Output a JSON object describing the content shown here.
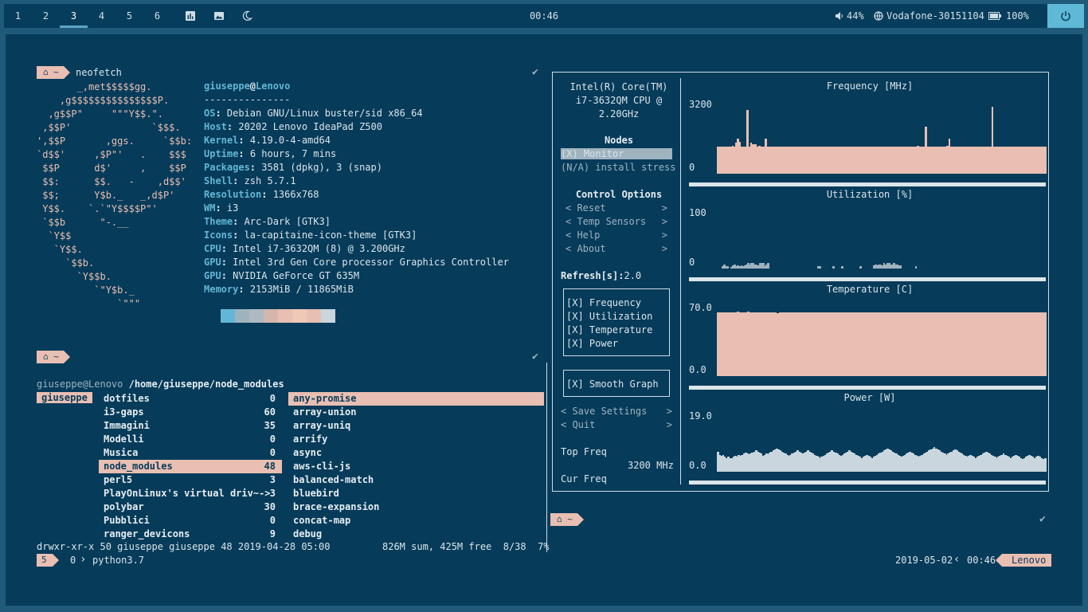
{
  "topbar": {
    "workspaces": [
      "1",
      "2",
      "3",
      "4",
      "5",
      "6"
    ],
    "active_workspace": "3",
    "clock": "00:46",
    "volume": "44%",
    "network": "Vodafone-30151104",
    "battery": "100%"
  },
  "term1": {
    "prompt_dir": "~",
    "command": "neofetch",
    "logo_lines": [
      "       _,met$$$$$gg.",
      "    ,g$$$$$$$$$$$$$$$P.",
      "  ,g$$P\"     \"\"\"Y$$.\".",
      " ,$$P'              `$$$.",
      "',$$P       ,ggs.     `$$b:",
      "`d$$'     ,$P\"'   .    $$$",
      " $$P      d$'     ,    $$P",
      " $$:      $$.   -    ,d$$'",
      " $$;      Y$b._   _,d$P'",
      " Y$$.    `.`\"Y$$$$P\"'",
      " `$$b      \"-.__",
      "  `Y$$",
      "   `Y$$.",
      "     `$$b.",
      "       `Y$$b.",
      "          `\"Y$b._",
      "              `\"\"\""
    ],
    "user": "giuseppe",
    "host": "Lenovo",
    "divider": "---------------",
    "info": [
      {
        "k": "OS",
        "v": "Debian GNU/Linux buster/sid x86_64"
      },
      {
        "k": "Host",
        "v": "20202 Lenovo IdeaPad Z500"
      },
      {
        "k": "Kernel",
        "v": "4.19.0-4-amd64"
      },
      {
        "k": "Uptime",
        "v": "6 hours, 7 mins"
      },
      {
        "k": "Packages",
        "v": "3581 (dpkg), 3 (snap)"
      },
      {
        "k": "Shell",
        "v": "zsh 5.7.1"
      },
      {
        "k": "Resolution",
        "v": "1366x768"
      },
      {
        "k": "WM",
        "v": "i3"
      },
      {
        "k": "Theme",
        "v": "Arc-Dark [GTK3]"
      },
      {
        "k": "Icons",
        "v": "la-capitaine-icon-theme [GTK3]"
      },
      {
        "k": "CPU",
        "v": "Intel i7-3632QM (8) @ 3.200GHz"
      },
      {
        "k": "GPU",
        "v": "Intel 3rd Gen Core processor Graphics Controller"
      },
      {
        "k": "GPU",
        "v": "NVIDIA GeForce GT 635M"
      },
      {
        "k": "Memory",
        "v": "2153MiB / 11865MiB"
      }
    ],
    "palette": [
      "#63b7d6",
      "#9fb3bf",
      "#aebac2",
      "#d4b6ad",
      "#e8bfb2",
      "#f0c8b8",
      "#e8bfb2",
      "#c9d6dd"
    ]
  },
  "ranger": {
    "prompt_dir": "~",
    "path_user": "giuseppe@Lenovo",
    "path": "/home/giuseppe/node_modules",
    "parent_dir": "giuseppe",
    "dirs": [
      {
        "name": "dotfiles",
        "count": "0"
      },
      {
        "name": "i3-gaps",
        "count": "60"
      },
      {
        "name": "Immagini",
        "count": "35"
      },
      {
        "name": "Modelli",
        "count": "0"
      },
      {
        "name": "Musica",
        "count": "0"
      },
      {
        "name": "node_modules",
        "count": "48"
      },
      {
        "name": "perl5",
        "count": "3"
      },
      {
        "name": "PlayOnLinux's virtual driv~-> ",
        "count": "3"
      },
      {
        "name": "polybar",
        "count": "30"
      },
      {
        "name": "Pubblici",
        "count": "0"
      },
      {
        "name": "ranger_devicons",
        "count": "9"
      }
    ],
    "selected_dir": "node_modules",
    "preview": [
      "any-promise",
      "array-union",
      "array-uniq",
      "arrify",
      "async",
      "aws-cli-js",
      "balanced-match",
      "bluebird",
      "brace-expansion",
      "concat-map",
      "debug"
    ],
    "status_left": "drwxr-xr-x 50 giuseppe giuseppe 48 2019-04-28 05:00",
    "status_right": "826M sum, 425M free  8/38  7%",
    "tmux_window": "5",
    "tmux_pane": "0",
    "tmux_proc": "python3.7"
  },
  "monitor": {
    "cpu_name": [
      "Intel(R) Core(TM)",
      "i7-3632QM CPU @",
      "2.20GHz"
    ],
    "nodes_title": "Nodes",
    "nodes": [
      "(X) Monitor",
      "(N/A) install stress"
    ],
    "control_title": "Control Options",
    "controls": [
      "Reset",
      "Temp Sensors",
      "Help",
      "About"
    ],
    "refresh_label": "Refresh[s]:",
    "refresh_value": "2.0",
    "checks": [
      "[X] Frequency",
      "[X] Utilization",
      "[X] Temperature",
      "[X] Power"
    ],
    "smooth": "[X] Smooth Graph",
    "save": "Save Settings",
    "quit": "Quit",
    "top_freq_label": "Top Freq",
    "top_freq_value": "3200 MHz",
    "cur_freq_label": "Cur Freq",
    "graphs": [
      {
        "title": "Frequency [MHz]",
        "ymax": "3200",
        "ymin": "0",
        "color": "#e8bfb2",
        "values": [
          40,
          40,
          40,
          40,
          40,
          40,
          40,
          40,
          40,
          42,
          40,
          46,
          52,
          48,
          40,
          40,
          40,
          40,
          95,
          40,
          46,
          44,
          44,
          44,
          40,
          42,
          40,
          40,
          40,
          52,
          40,
          40,
          40,
          40,
          40,
          40,
          40,
          40,
          40,
          40,
          40,
          40,
          40,
          40,
          40,
          40,
          40,
          40,
          40,
          40,
          40,
          40,
          40,
          40,
          40,
          40,
          40,
          40,
          40,
          40,
          40,
          40,
          40,
          40,
          40,
          40,
          40,
          40,
          40,
          40,
          40,
          40,
          40,
          40,
          40,
          40,
          40,
          40,
          40,
          40,
          40,
          40,
          40,
          40,
          40,
          40,
          40,
          40,
          40,
          40,
          40,
          40,
          40,
          40,
          40,
          40,
          40,
          40,
          40,
          40,
          40,
          40,
          40,
          40,
          40,
          40,
          40,
          40,
          40,
          40,
          40,
          40,
          40,
          40,
          40,
          40,
          40,
          40,
          40,
          40,
          40,
          42,
          40,
          40,
          40,
          40,
          70,
          40,
          40,
          40,
          40,
          40,
          40,
          40,
          40,
          40,
          40,
          40,
          40,
          42,
          52,
          40,
          40,
          40,
          40,
          40,
          40,
          40,
          40,
          40,
          40,
          40,
          40,
          40,
          40,
          40,
          40,
          40,
          40,
          40,
          40,
          40,
          40,
          40,
          40,
          40,
          100,
          40,
          40,
          40,
          40,
          40,
          40,
          40,
          40,
          40,
          40,
          40,
          40,
          40,
          40,
          40,
          40,
          40,
          40,
          40,
          40,
          40,
          40,
          40,
          40,
          40,
          40,
          40,
          40,
          40,
          40,
          40,
          40
        ]
      },
      {
        "title": "Utilization [%]",
        "ymax": "100",
        "ymin": "0",
        "color": "#9fb3bf",
        "values": [
          0,
          0,
          0,
          5,
          8,
          4,
          4,
          0,
          3,
          6,
          8,
          4,
          6,
          4,
          6,
          5,
          6,
          8,
          10,
          8,
          10,
          10,
          8,
          8,
          6,
          10,
          10,
          10,
          5,
          8,
          10,
          0,
          0,
          0,
          0,
          0,
          0,
          0,
          0,
          0,
          0,
          0,
          0,
          0,
          0,
          0,
          0,
          0,
          0,
          0,
          0,
          0,
          0,
          0,
          0,
          0,
          0,
          0,
          0,
          0,
          5,
          5,
          0,
          0,
          0,
          0,
          0,
          0,
          0,
          5,
          0,
          0,
          0,
          0,
          5,
          0,
          0,
          0,
          0,
          0,
          0,
          0,
          0,
          0,
          0,
          4,
          0,
          0,
          0,
          0,
          0,
          0,
          0,
          6,
          8,
          6,
          8,
          8,
          6,
          10,
          8,
          10,
          10,
          8,
          8,
          10,
          8,
          8,
          6,
          6,
          0,
          0,
          0,
          0,
          0,
          0,
          0,
          0,
          5,
          0,
          0,
          0,
          0,
          0,
          0,
          0,
          0,
          0,
          0,
          0,
          0,
          0,
          0,
          0,
          0,
          0,
          0,
          0,
          0,
          0,
          0,
          0,
          0,
          0,
          0,
          0,
          0,
          0,
          0,
          0,
          0,
          0,
          0,
          0,
          0,
          0,
          0,
          0,
          0,
          0,
          0,
          0,
          0,
          0,
          0,
          0,
          0,
          0,
          0,
          0,
          0,
          0,
          0,
          0,
          0,
          0,
          0,
          0,
          0,
          0,
          0,
          0,
          0,
          0,
          0,
          0,
          0,
          0,
          0,
          0,
          0,
          0,
          0,
          0,
          0,
          0
        ]
      },
      {
        "title": "Temperature [C]",
        "ymax": "70.0",
        "ymin": "0.0",
        "color": "#e8bfb2",
        "values": [
          96,
          97,
          96,
          96,
          97,
          96,
          96,
          96,
          97,
          96,
          97,
          97,
          98,
          96,
          96,
          97,
          96,
          97,
          98,
          97,
          97,
          97,
          96,
          96,
          96,
          96,
          96,
          96,
          96,
          97,
          97,
          96,
          96,
          96,
          96,
          95,
          95,
          96,
          96,
          96,
          96,
          96,
          97,
          97,
          96,
          96,
          96,
          96,
          96,
          96,
          96,
          96,
          96,
          96,
          96,
          96,
          96,
          96,
          96,
          96,
          96,
          96,
          96,
          96,
          96,
          96,
          96,
          96,
          96,
          96,
          96,
          96,
          96,
          96,
          96,
          96,
          96,
          96,
          96,
          96,
          96,
          96,
          96,
          96,
          96,
          96,
          96,
          96,
          96,
          96,
          96,
          96,
          96,
          96,
          96,
          96,
          96,
          96,
          96,
          96,
          96,
          96,
          96,
          96,
          96,
          96,
          96,
          96,
          96,
          96,
          96,
          96,
          96,
          96,
          96,
          96,
          96,
          96,
          96,
          96,
          96,
          96,
          96,
          96,
          96,
          96,
          96,
          96,
          96,
          96,
          96,
          96,
          96,
          96,
          96,
          96,
          96,
          96,
          96,
          96,
          96,
          96,
          96,
          96,
          96,
          96,
          96,
          96,
          96,
          96,
          96,
          96,
          96,
          96,
          96,
          96,
          96,
          96,
          96,
          96,
          96,
          96,
          96,
          96,
          96,
          96,
          96,
          96,
          96,
          96,
          96,
          96,
          96,
          96,
          96,
          96,
          96,
          96,
          96,
          96,
          96,
          96,
          96,
          96,
          96,
          96,
          96,
          96,
          96,
          96,
          96,
          96,
          96,
          96,
          96
        ]
      },
      {
        "title": "Power [W]",
        "ymax": "19.0",
        "ymin": "0.0",
        "color": "#c9d6dd",
        "values": [
          38,
          32,
          30,
          32,
          28,
          25,
          28,
          25,
          26,
          28,
          30,
          28,
          32,
          30,
          32,
          34,
          36,
          35,
          33,
          34,
          36,
          38,
          40,
          38,
          36,
          34,
          30,
          32,
          34,
          33,
          36,
          38,
          40,
          42,
          44,
          42,
          40,
          38,
          36,
          34,
          32,
          30,
          32,
          34,
          36,
          38,
          40,
          38,
          36,
          34,
          36,
          38,
          40,
          38,
          36,
          34,
          32,
          30,
          28,
          26,
          28,
          30,
          32,
          34,
          36,
          38,
          40,
          38,
          36,
          34,
          32,
          30,
          32,
          34,
          36,
          38,
          40,
          38,
          36,
          34,
          32,
          30,
          28,
          26,
          28,
          30,
          32,
          30,
          28,
          26,
          28,
          30,
          32,
          34,
          36,
          38,
          40,
          42,
          44,
          42,
          40,
          38,
          36,
          34,
          32,
          30,
          28,
          30,
          32,
          34,
          36,
          38,
          36,
          34,
          32,
          30,
          28,
          30,
          32,
          34,
          36,
          38,
          40,
          42,
          44,
          46,
          44,
          42,
          40,
          38,
          36,
          34,
          32,
          34,
          36,
          38,
          40,
          42,
          40,
          38,
          36,
          34,
          32,
          30,
          28,
          30,
          32,
          30,
          28,
          26,
          28,
          30,
          32,
          34,
          36,
          38,
          36,
          34,
          32,
          30,
          28,
          26,
          28,
          30,
          32,
          34,
          32,
          30,
          28,
          26,
          28,
          30,
          32,
          30,
          28,
          26,
          24,
          26,
          28,
          30,
          32,
          30,
          28,
          26,
          28,
          30,
          28,
          26,
          24,
          26
        ]
      }
    ]
  },
  "term3": {
    "prompt_dir": "~"
  },
  "tmux_status": {
    "date": "2019-05-02",
    "time": "00:46",
    "host": "Lenovo"
  },
  "icons": {
    "check": "✔",
    "home": "⌂",
    "volume": "speaker-icon",
    "network": "globe-icon",
    "battery": "battery-icon",
    "power": "power-icon"
  }
}
